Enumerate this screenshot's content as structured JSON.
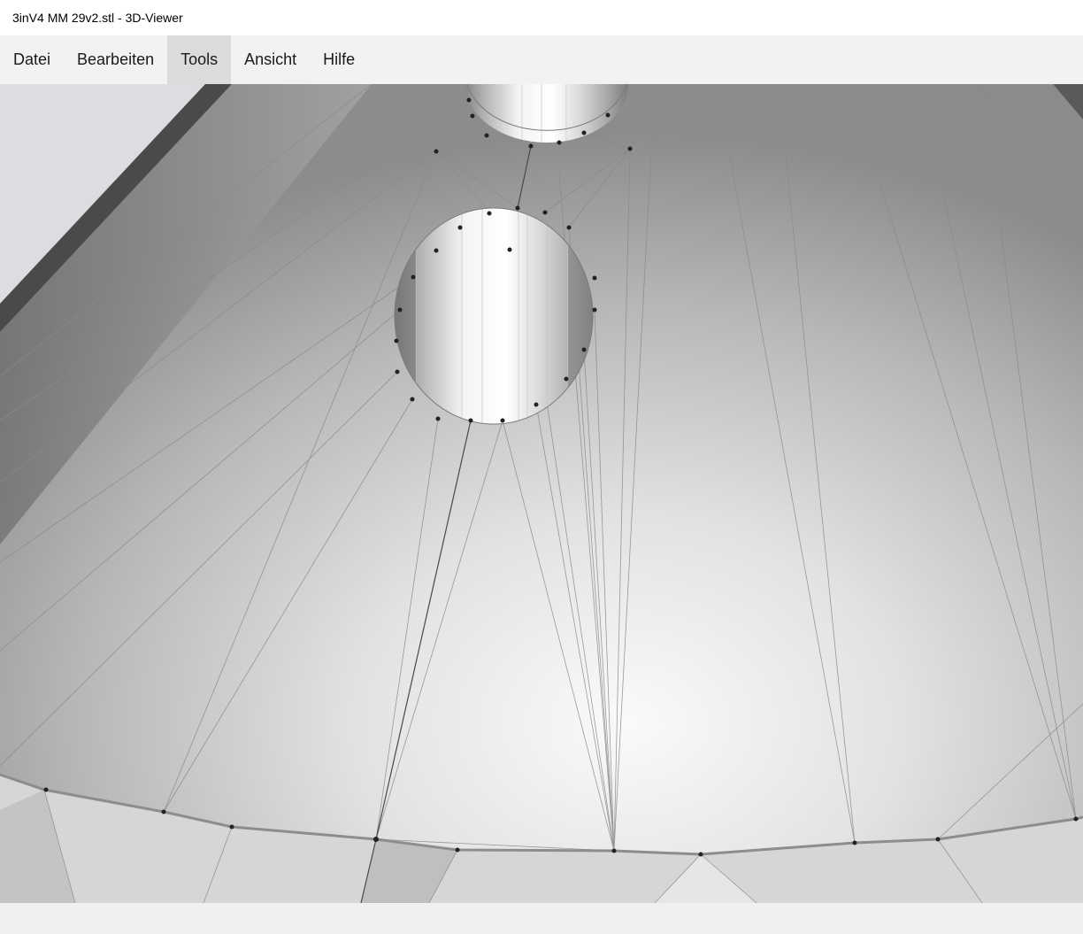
{
  "window": {
    "title": "3inV4 MM 29v2.stl - 3D-Viewer"
  },
  "menu": {
    "items": [
      {
        "label": "Datei",
        "name": "menu-datei",
        "active": false
      },
      {
        "label": "Bearbeiten",
        "name": "menu-bearbeiten",
        "active": false
      },
      {
        "label": "Tools",
        "name": "menu-tools",
        "active": true
      },
      {
        "label": "Ansicht",
        "name": "menu-ansicht",
        "active": false
      },
      {
        "label": "Hilfe",
        "name": "menu-hilfe",
        "active": false
      }
    ]
  },
  "viewport": {
    "content": "3d-mesh-view",
    "colors": {
      "surface": "#d9d9d9",
      "edge": "#7a7a7a",
      "vertex": "#222222"
    }
  }
}
